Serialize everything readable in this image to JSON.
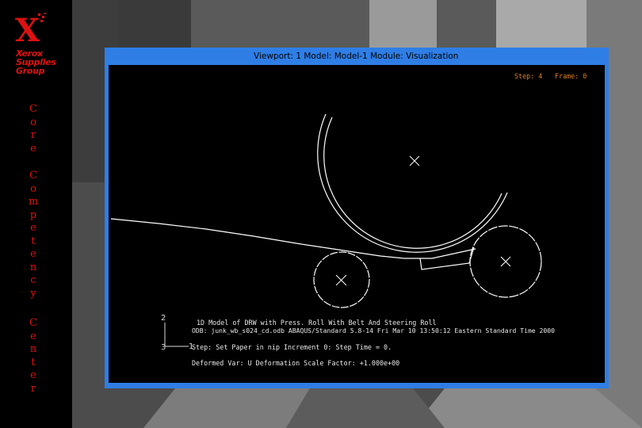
{
  "brand": {
    "logo_letter": "X",
    "logo_lines": [
      "Xerox",
      "Supplies",
      "Group"
    ],
    "color": "#dd1111"
  },
  "sidebar": {
    "vertical_words": [
      "Core",
      "Competency",
      "Center"
    ]
  },
  "window": {
    "title": "Viewport: 1  Model: Model-1  Module: Visualization",
    "title_bar_color": "#2f7ee6"
  },
  "viewport": {
    "step_label": "Step: 4",
    "frame_label": "Frame: 0",
    "triad": {
      "axis_up": "2",
      "axis_right": "1",
      "axis_origin": "3"
    },
    "info_lines": [
      "1D Model of DRW with Press. Roll   With Belt And Steering Roll",
      "ODB: junk_wb_s024_cd.odb    ABAQUS/Standard 5.8-14    Fri Mar 10 13:50:12 Eastern Standard Time 2000",
      "Step: Set Paper in nip   Increment     0: Step Time =        0.",
      "Deformed Var: U   Deformation Scale Factor: +1.000e+00"
    ]
  }
}
